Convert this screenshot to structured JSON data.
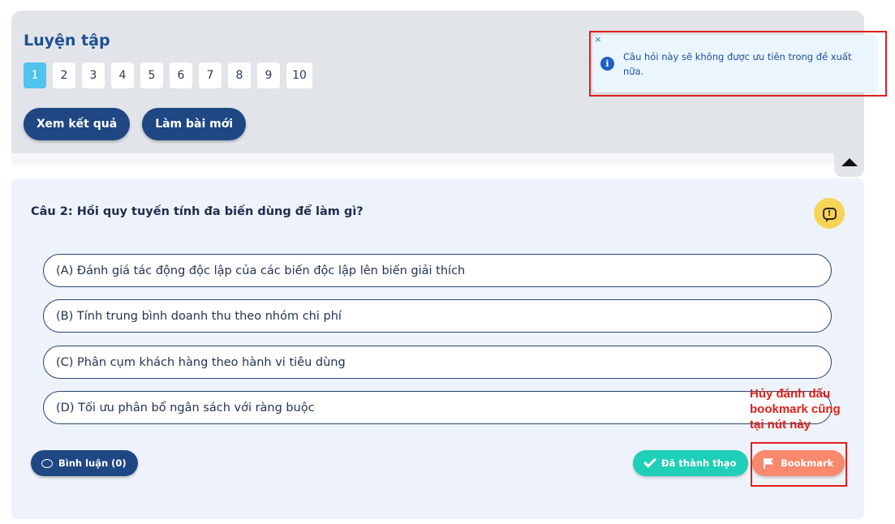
{
  "practice": {
    "title": "Luyện tập",
    "pages": [
      "1",
      "2",
      "3",
      "4",
      "5",
      "6",
      "7",
      "8",
      "9",
      "10"
    ],
    "active_page": "1",
    "view_results_label": "Xem kết quả",
    "new_attempt_label": "Làm bài mới",
    "collapse_icon": "triangle-up-icon"
  },
  "toast": {
    "message": "Câu hỏi này sẽ không được ưu tiên trong đề xuất nữa.",
    "close_glyph": "×",
    "info_glyph": "i",
    "highlight_color": "#e01e1e"
  },
  "question": {
    "text": "Câu 2: Hồi quy tuyến tính đa biến dùng để làm gì?",
    "report_glyph": "!",
    "options": [
      "(A) Đánh giá tác động độc lập của các biến độc lập lên biến giải thích",
      "(B) Tính trung bình doanh thu theo nhóm chi phí",
      "(C) Phân cụm khách hàng theo hành vi tiêu dùng",
      "(D) Tối ưu phân bổ ngân sách với ràng buộc"
    ],
    "comment_label": "Bình luận (0)",
    "mastered_label": "Đã thành thạo",
    "bookmark_label": "Bookmark"
  },
  "annotation": {
    "line1": "Hủy đánh dấu",
    "line2": "bookmark cũng",
    "line3": "tại nút này",
    "color": "#e0201a"
  },
  "colors": {
    "accent_dark": "#1e4784",
    "active_page": "#4fc3ec",
    "mastered": "#1fcfb7",
    "bookmark": "#f8896d",
    "report": "#f7d358"
  }
}
